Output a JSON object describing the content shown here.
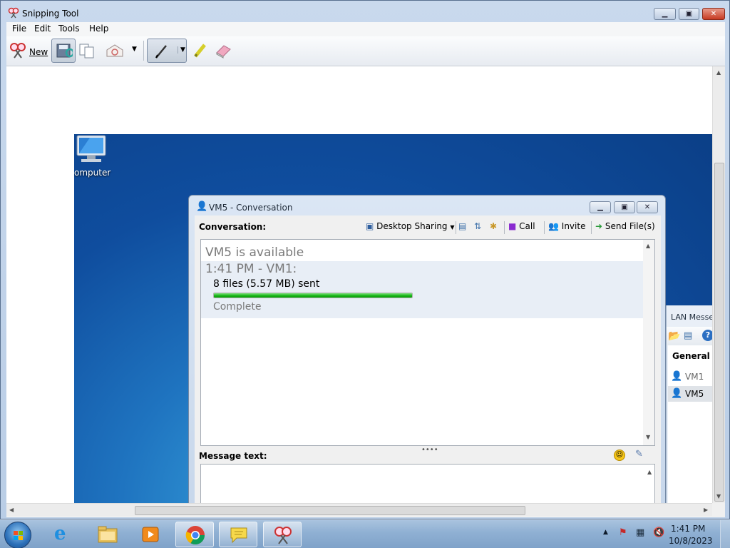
{
  "snipping_tool": {
    "title": "Snipping Tool",
    "menu": [
      "File",
      "Edit",
      "Tools",
      "Help"
    ],
    "toolbar": {
      "new_label": "New"
    }
  },
  "desktop": {
    "computer_label": "omputer"
  },
  "conversation": {
    "title": "VM5 - Conversation",
    "label": "Conversation:",
    "toolbar": {
      "desktop_sharing": "Desktop Sharing",
      "call": "Call",
      "invite": "Invite",
      "send_files": "Send File(s)"
    },
    "history": {
      "status": "VM5 is available",
      "timestamp": "1:41 PM - VM1:",
      "files": "8 files (5.57 MB) sent",
      "progress_percent": 100,
      "result": "Complete"
    },
    "message_label": "Message text:"
  },
  "lan_messenger": {
    "title": "LAN Messen",
    "group": "General",
    "users": [
      "VM1",
      "VM5"
    ],
    "selected_user": "VM5"
  },
  "taskbar": {
    "time": "1:41 PM",
    "date": "10/8/2023"
  },
  "colors": {
    "progress": "#12b312",
    "desktop": "#1f74c0",
    "close_button": "#c63a22"
  }
}
